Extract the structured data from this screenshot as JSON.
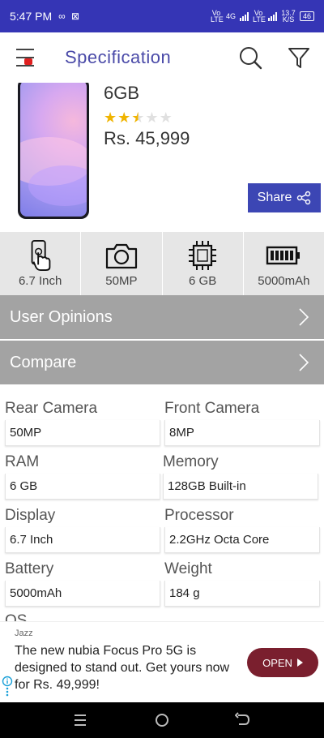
{
  "status_bar": {
    "time": "5:47 PM",
    "notification_icons": "∞ ⊠",
    "net_label_1": "Vo LTE",
    "net_type": "4G",
    "net_label_2": "Vo LTE",
    "speed": "13.7 K/S",
    "battery": "46"
  },
  "header": {
    "title": "Specification",
    "menu_icon": "menu-icon",
    "search_icon": "search-icon",
    "filter_icon": "filter-icon"
  },
  "product": {
    "name_partial": "6GB",
    "rating": 2.5,
    "rating_max": 5,
    "price": "Rs. 45,999",
    "share_label": "Share"
  },
  "key_specs": [
    {
      "icon": "touch-phone-icon",
      "label": "6.7 Inch"
    },
    {
      "icon": "camera-icon",
      "label": "50MP"
    },
    {
      "icon": "chip-icon",
      "label": "6 GB"
    },
    {
      "icon": "battery-icon",
      "label": "5000mAh"
    }
  ],
  "sections": {
    "user_opinions": "User Opinions",
    "compare": "Compare"
  },
  "spec_fields": [
    {
      "label": "Rear Camera",
      "value": "50MP"
    },
    {
      "label": "Front Camera",
      "value": "8MP"
    },
    {
      "label": "RAM",
      "value": "6 GB"
    },
    {
      "label": "Memory",
      "value": "128GB Built-in"
    },
    {
      "label": "Display",
      "value": "6.7 Inch"
    },
    {
      "label": "Processor",
      "value": "2.2GHz Octa Core"
    },
    {
      "label": "Battery",
      "value": "5000mAh"
    },
    {
      "label": "Weight",
      "value": "184 g"
    },
    {
      "label": "OS",
      "value": ""
    }
  ],
  "ad": {
    "sponsor": "Jazz",
    "copy": "The new nubia Focus Pro 5G is designed to stand out. Get yours now for Rs. 49,999!",
    "button": "OPEN"
  },
  "colors": {
    "status_bar": "#3535b5",
    "accent": "#4a4aa8",
    "share_button": "#3c46b4",
    "section_bar": "#a3a3a3",
    "ad_button": "#7a1f2e"
  }
}
